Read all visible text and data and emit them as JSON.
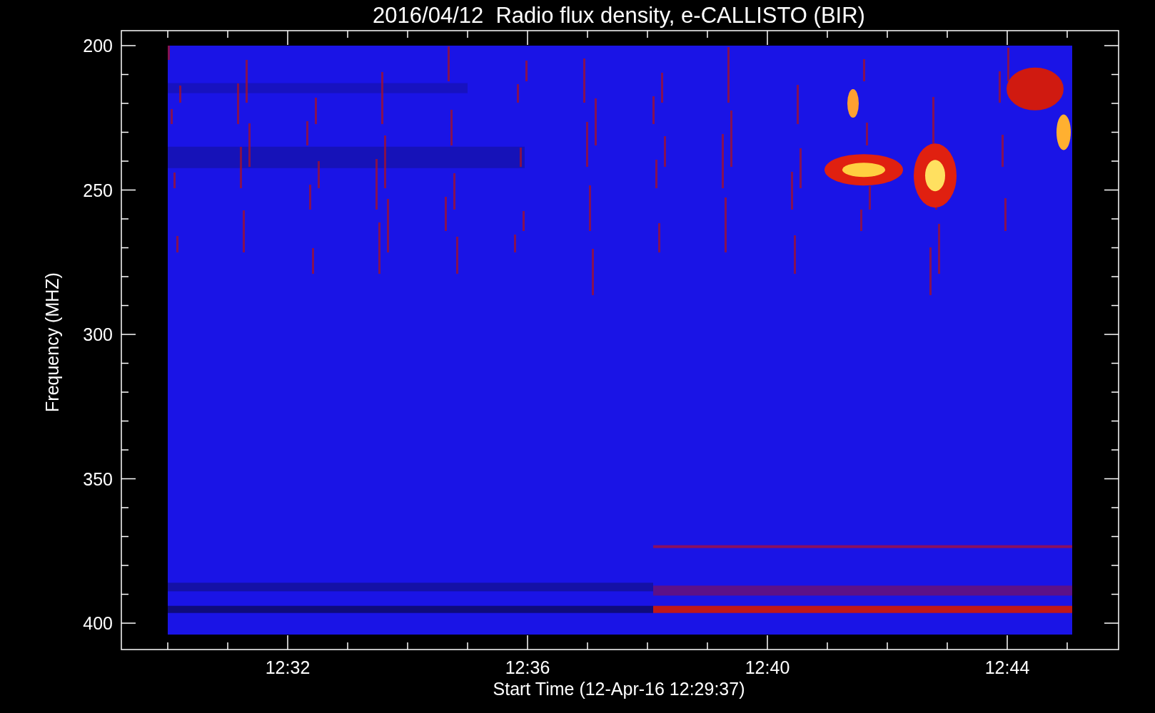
{
  "title": "2016/04/12  Radio flux density, e-CALLISTO (BIR)",
  "y_axis": {
    "label": "Frequency (MHZ)",
    "ticks": [
      "200",
      "250",
      "300",
      "350",
      "400"
    ]
  },
  "x_axis": {
    "label": "Start Time (12-Apr-16 12:29:37)",
    "ticks": [
      "12:32",
      "12:36",
      "12:40",
      "12:44"
    ]
  }
}
